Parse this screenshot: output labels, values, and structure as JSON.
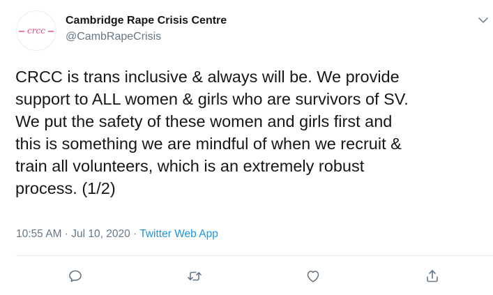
{
  "author": {
    "display_name": "Cambridge Rape Crisis Centre",
    "handle": "@CambRapeCrisis",
    "avatar_text": "crcc"
  },
  "tweet": {
    "text": "CRCC is trans inclusive & always will be. We provide\nsupport to ALL women & girls who are survivors of SV.\nWe put the safety of these women and girls first and\nthis is something we are mindful of when we recruit &\ntrain all volunteers, which is an extremely robust\nprocess. (1/2)"
  },
  "meta": {
    "time": "10:55 AM",
    "separator_1": " · ",
    "date": "Jul 10, 2020",
    "separator_2": " · ",
    "source": "Twitter Web App"
  },
  "actions": [
    {
      "icon": "reply-icon"
    },
    {
      "icon": "retweet-icon"
    },
    {
      "icon": "like-icon"
    },
    {
      "icon": "share-icon"
    }
  ],
  "colors": {
    "text": "#14171a",
    "secondary": "#657786",
    "link": "#1b95e0",
    "logo": "#e0457b",
    "border": "#e6ecf0"
  }
}
